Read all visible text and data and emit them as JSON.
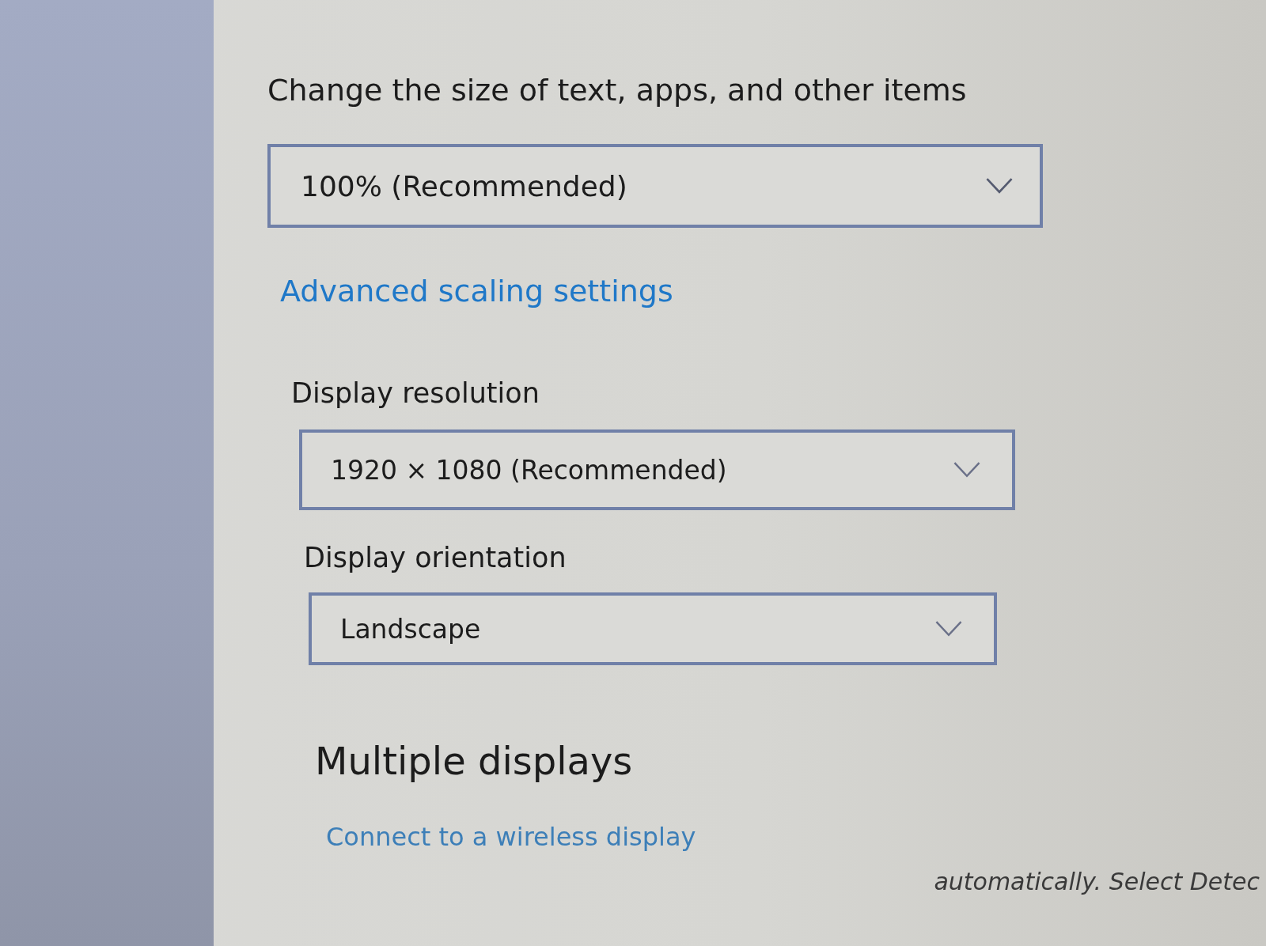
{
  "scale": {
    "heading": "Change the size of text, apps, and other items",
    "dropdown": {
      "value": "100% (Recommended)"
    },
    "link": "Advanced scaling settings"
  },
  "resolution": {
    "label": "Display resolution",
    "dropdown": {
      "value": "1920 × 1080 (Recommended)"
    }
  },
  "orientation": {
    "label": "Display orientation",
    "dropdown": {
      "value": "Landscape"
    }
  },
  "multiple_displays": {
    "heading": "Multiple displays",
    "link": "Connect to a wireless display",
    "note": "automatically. Select Detec"
  }
}
